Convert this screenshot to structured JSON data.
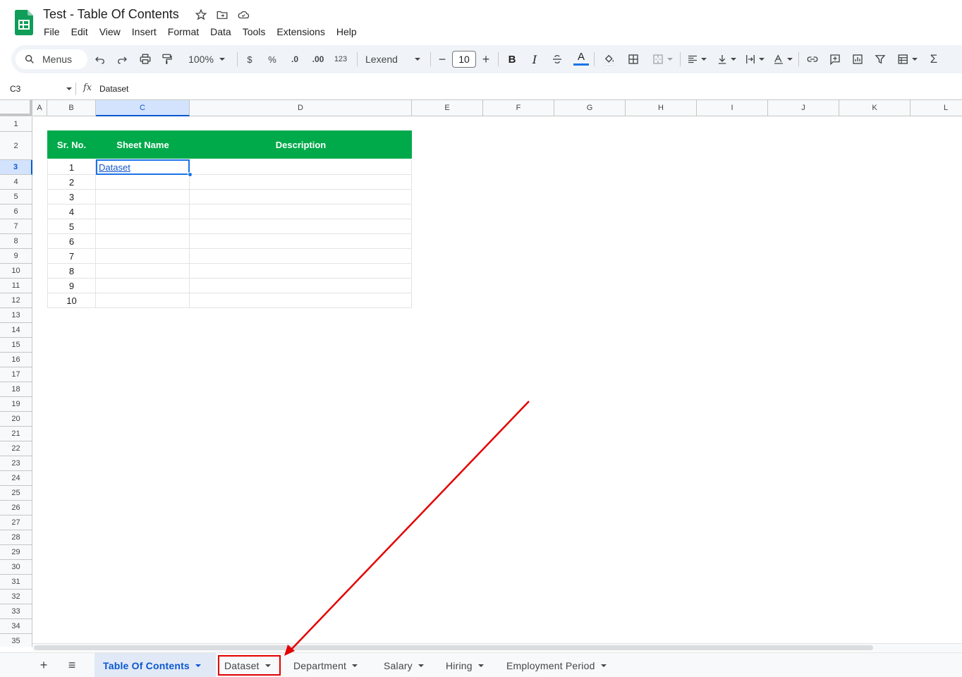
{
  "app": {
    "doc_title": "Test - Table Of Contents",
    "menu": [
      "File",
      "Edit",
      "View",
      "Insert",
      "Format",
      "Data",
      "Tools",
      "Extensions",
      "Help"
    ]
  },
  "toolbar": {
    "search_label": "Menus",
    "zoom": "100%",
    "currency": "$",
    "percent": "%",
    "dec_decrease": ".0",
    "dec_increase": ".00",
    "number_format": "123",
    "font": "Lexend",
    "font_size": "10",
    "minus": "−",
    "plus": "+",
    "bold": "B",
    "italic": "I",
    "text_color": "A",
    "sum": "Σ"
  },
  "formula_bar": {
    "cell_ref": "C3",
    "fx": "fx",
    "value": "Dataset"
  },
  "grid": {
    "columns": [
      "A",
      "B",
      "C",
      "D",
      "E",
      "F",
      "G",
      "H",
      "I",
      "J",
      "K",
      "L"
    ],
    "selected_column": "C",
    "rows": [
      "1",
      "2",
      "3",
      "4",
      "5",
      "6",
      "7",
      "8",
      "9",
      "10",
      "11",
      "12",
      "13",
      "14",
      "15",
      "16",
      "17",
      "18",
      "19",
      "20",
      "21",
      "22",
      "23",
      "24",
      "25",
      "26",
      "27",
      "28",
      "29",
      "30",
      "31",
      "32",
      "33",
      "34",
      "35"
    ],
    "selected_row": "3",
    "table": {
      "headers": [
        "Sr. No.",
        "Sheet Name",
        "Description"
      ],
      "header_color": "#00aa4a",
      "sr_nos": [
        "1",
        "2",
        "3",
        "4",
        "5",
        "6",
        "7",
        "8",
        "9",
        "10"
      ],
      "sheet_names": [
        "Dataset",
        "",
        "",
        "",
        "",
        "",
        "",
        "",
        "",
        ""
      ]
    }
  },
  "sheet_tabs": {
    "add": "+",
    "list": "≡",
    "tabs": [
      "Table Of Contents",
      "Dataset",
      "Department",
      "Salary",
      "Hiring",
      "Employment Period"
    ],
    "active": "Table Of Contents",
    "highlight_color": "#e30000"
  }
}
